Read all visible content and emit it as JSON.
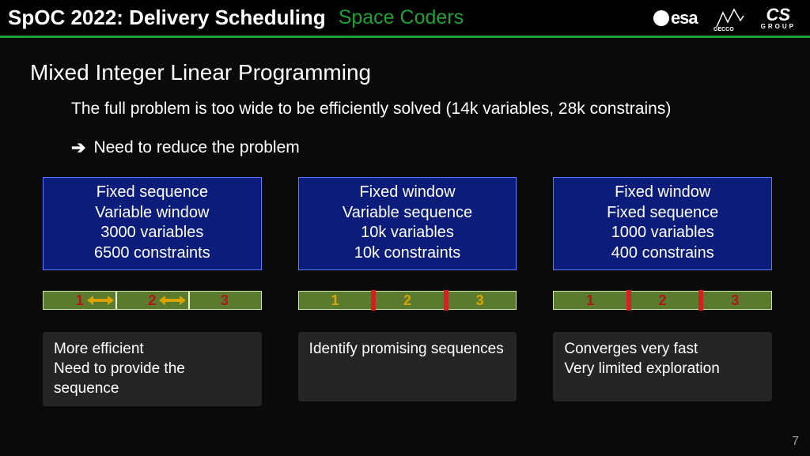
{
  "header": {
    "title": "SpOC 2022: Delivery Scheduling",
    "team": "Space Coders",
    "logos": {
      "esa": "esa",
      "gecco": "GECCO",
      "cs_top": "CS",
      "cs_bot": "GROUP"
    }
  },
  "section_title": "Mixed Integer Linear Programming",
  "intro": "The full problem is too wide to be efficiently solved (14k variables, 28k constrains)",
  "need": "Need to reduce the problem",
  "cols": [
    {
      "box": [
        "Fixed sequence",
        "Variable window",
        "3000 variables",
        "6500 constraints"
      ],
      "labels": [
        "1",
        "2",
        "3"
      ],
      "caption": "More efficient\nNeed to provide the sequence"
    },
    {
      "box": [
        "Fixed window",
        "Variable sequence",
        "10k variables",
        "10k constraints"
      ],
      "labels": [
        "1",
        "2",
        "3"
      ],
      "caption": "Identify promising sequences"
    },
    {
      "box": [
        "Fixed window",
        "Fixed sequence",
        "1000 variables",
        "400 constrains"
      ],
      "labels": [
        "1",
        "2",
        "3"
      ],
      "caption": "Converges very fast\nVery limited exploration"
    }
  ],
  "page_number": "7"
}
